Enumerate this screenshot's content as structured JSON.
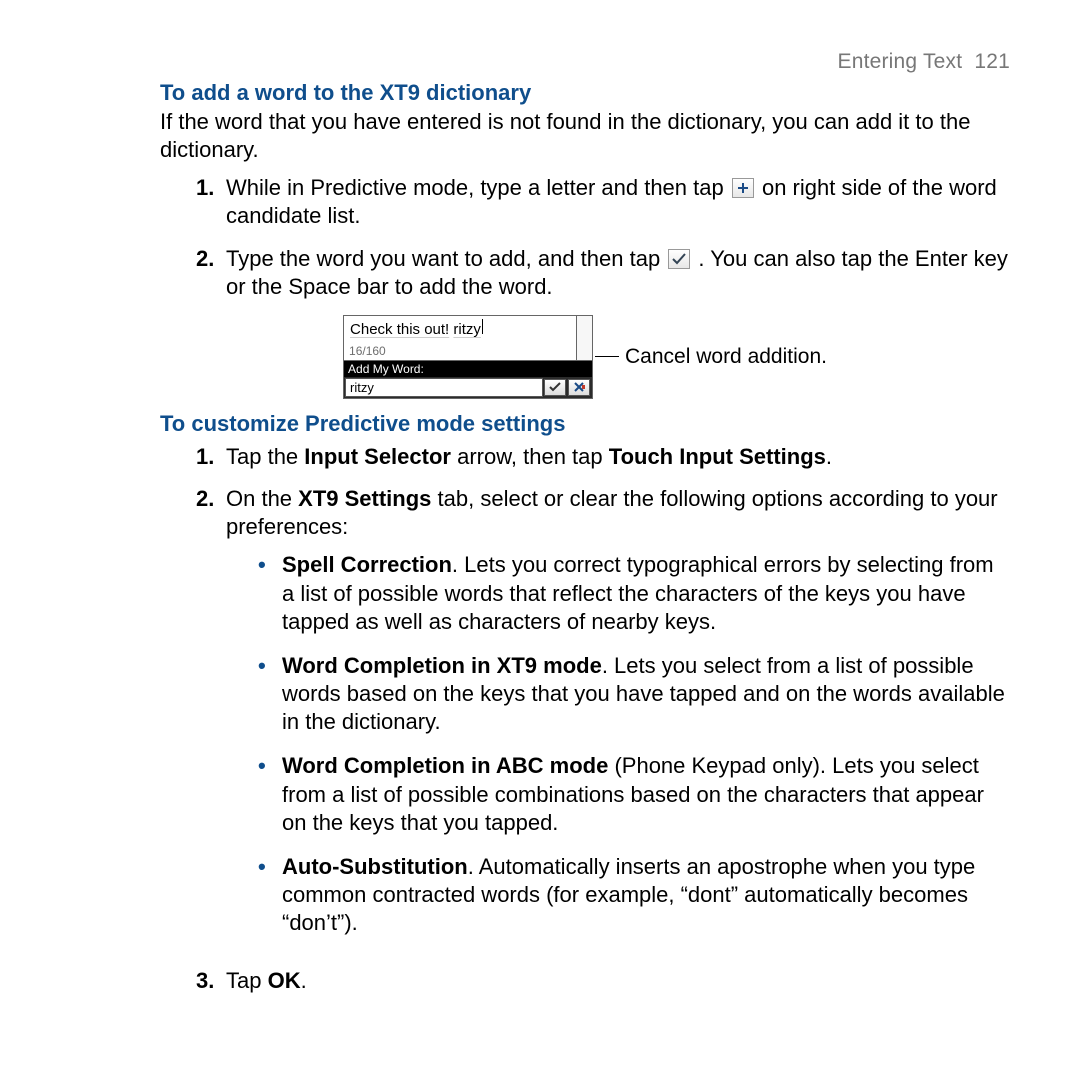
{
  "runhead": {
    "section": "Entering Text",
    "page": "121"
  },
  "sec1": {
    "title": "To add a word to the XT9 dictionary",
    "intro": "If the word that you have entered is not found in the dictionary, you can add it to the dictionary.",
    "step1_a": "While in Predictive mode, type a letter and then tap ",
    "step1_b": " on right side of the word candidate list.",
    "step2_a": "Type the word you want to add, and then tap ",
    "step2_b": " . You can also tap the Enter key or the Space bar to add the word."
  },
  "figure": {
    "msg_text": "Check this out!",
    "msg_word": "ritzy",
    "counter": "16/160",
    "header": "Add My Word:",
    "field_value": "ritzy",
    "callout": "Cancel word addition."
  },
  "sec2": {
    "title": "To customize Predictive mode settings",
    "step1_a": "Tap the ",
    "step1_b": "Input Selector",
    "step1_c": "arrow, then tap",
    "step1_d": "Touch Input Settings",
    "step1_e": ".",
    "step2_a": "On the ",
    "step2_b": "XT9 Settings",
    "step2_c": "tab, select or clear the following options according to your preferences:",
    "b1_t": "Spell Correction",
    "b1": ". Lets you correct typographical errors by selecting from a list of possible words that reflect the characters of the keys you have tapped as well as characters of nearby keys.",
    "b2_t": "Word Completion in XT9 mode",
    "b2": ". Lets you select from a list of possible words based on the keys that you have tapped and on the words available in the dictionary.",
    "b3_t": "Word Completion in ABC mode",
    "b3": "(Phone Keypad only). Lets you select from a list of possible combinations based on the characters that appear on the keys that you tapped.",
    "b4_t": "Auto-Substitution",
    "b4": ". Automatically inserts an apostrophe when you type common contracted words (for example, “dont” automatically becomes “don’t”).",
    "step3_a": "Tap ",
    "step3_b": "OK",
    "step3_c": "."
  },
  "nums": {
    "n1": "1.",
    "n2": "2.",
    "n3": "3."
  },
  "bullet": "•"
}
